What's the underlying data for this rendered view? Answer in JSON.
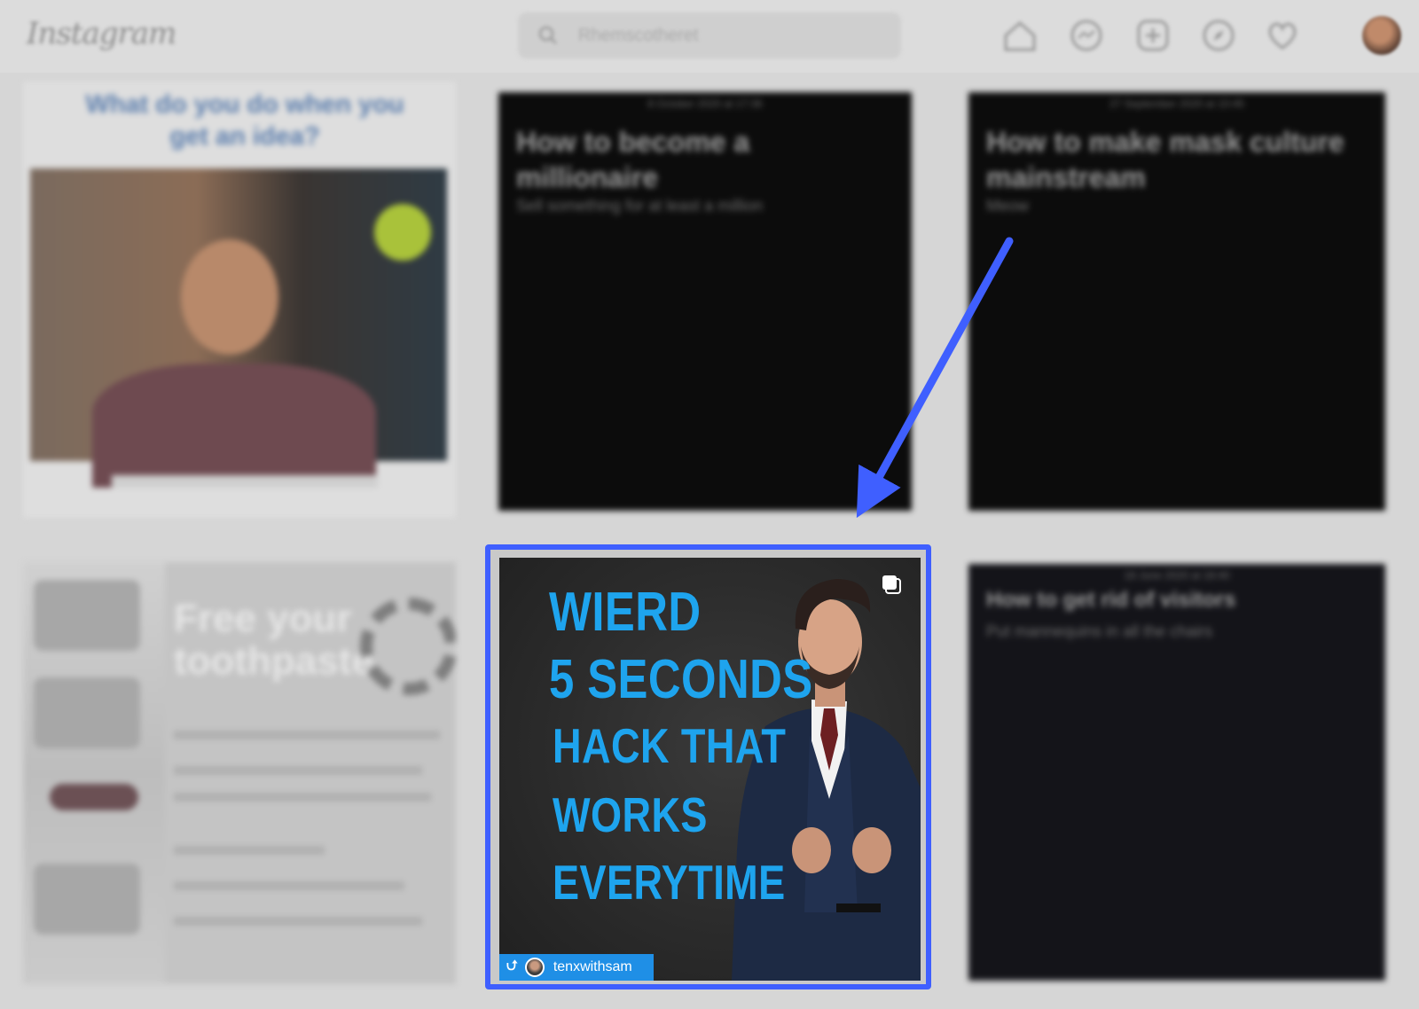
{
  "app": {
    "logo_text": "Instagram",
    "search_placeholder": "Rhemscotheret"
  },
  "nav_icons": [
    "home-icon",
    "messenger-icon",
    "new-post-icon",
    "explore-icon",
    "heart-icon",
    "profile-avatar"
  ],
  "tiles": {
    "tile1": {
      "headline": "What do you do when you get an idea?"
    },
    "tile2": {
      "date": "8 October 2020 at 17:36",
      "title": "How to become a millionaire",
      "subtitle": "Sell something for at least a million"
    },
    "tile3": {
      "date": "27 September 2020 at 10:45",
      "title": "How to make mask culture mainstream",
      "subtitle": "Meow"
    },
    "tile4": {
      "headline": "Free your toothpaste"
    },
    "tile5": {
      "date": "18 June 2020 at 18:40",
      "title": "How to get rid of visitors",
      "subtitle": "Put mannequins in all the chairs"
    }
  },
  "highlighted_post": {
    "lines": [
      "WIERD",
      "5 SECONDS",
      "HACK THAT",
      "WORKS",
      "EVERYTIME"
    ],
    "text_color": "#1ea4ee",
    "username": "tenxwithsam",
    "repost_icon": "repost-icon",
    "multi_icon": "carousel-icon"
  },
  "colors": {
    "highlight_border": "#3f5fff",
    "arrow": "#3f5fff"
  }
}
